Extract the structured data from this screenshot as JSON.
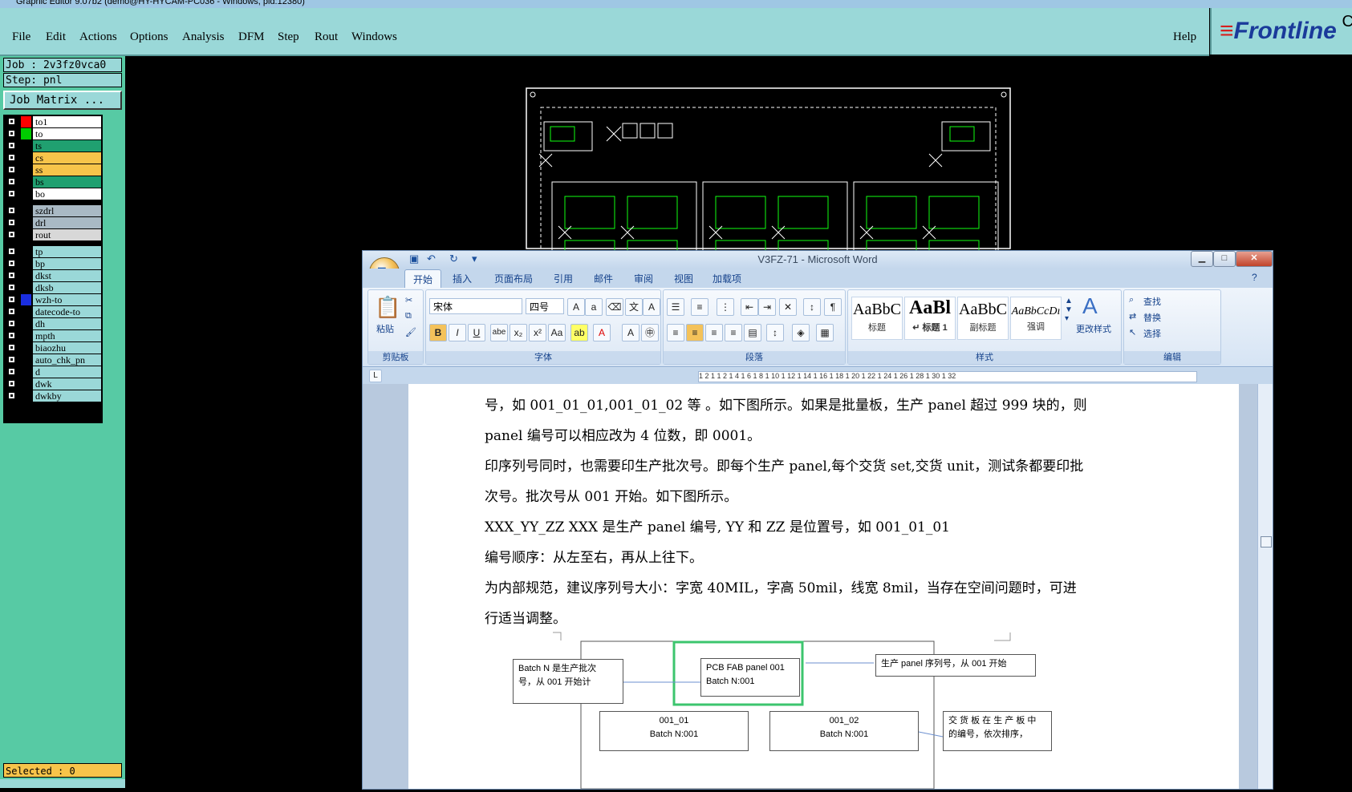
{
  "window_title": "Graphic Editor 9.07b2 (demo@HY-HYCAM-PC036 - Windows, pid:12380)",
  "menu": [
    {
      "label": "File"
    },
    {
      "label": "Edit"
    },
    {
      "label": "Actions"
    },
    {
      "label": "Options"
    },
    {
      "label": "Analysis"
    },
    {
      "label": "DFM"
    },
    {
      "label": "Step"
    },
    {
      "label": "Rout"
    },
    {
      "label": "Windows"
    }
  ],
  "help_label": "Help",
  "logo_text": "Frontline",
  "logo_suffix": "C",
  "job_info": "Job : 2v3fz0vca0",
  "step_info": "Step: pnl",
  "job_matrix_label": "Job Matrix ...",
  "selected_label": "Selected : 0",
  "layers": [
    {
      "name": "to1",
      "bg": "#ffffff",
      "swatch": "#ff0000"
    },
    {
      "name": "to",
      "bg": "#ffffff",
      "swatch": "#00cc00"
    },
    {
      "name": "ts",
      "bg": "#20a070",
      "swatch": ""
    },
    {
      "name": "cs",
      "bg": "#f7c44a",
      "swatch": ""
    },
    {
      "name": "ss",
      "bg": "#f7c44a",
      "swatch": ""
    },
    {
      "name": "bs",
      "bg": "#20a070",
      "swatch": ""
    },
    {
      "name": "bo",
      "bg": "#ffffff",
      "swatch": ""
    },
    {
      "name": "szdrl",
      "bg": "#a9b9c4",
      "swatch": ""
    },
    {
      "name": "drl",
      "bg": "#a9b9c4",
      "swatch": ""
    },
    {
      "name": "rout",
      "bg": "#d8d8d8",
      "swatch": ""
    },
    {
      "name": "tp",
      "bg": "#9ad8d8",
      "swatch": ""
    },
    {
      "name": "bp",
      "bg": "#9ad8d8",
      "swatch": ""
    },
    {
      "name": "dkst",
      "bg": "#9ad8d8",
      "swatch": ""
    },
    {
      "name": "dksb",
      "bg": "#9ad8d8",
      "swatch": ""
    },
    {
      "name": "wzh-to",
      "bg": "#9ad8d8",
      "swatch": "#1a2ee0"
    },
    {
      "name": "datecode-to",
      "bg": "#9ad8d8",
      "swatch": ""
    },
    {
      "name": "dh",
      "bg": "#9ad8d8",
      "swatch": ""
    },
    {
      "name": "mpth",
      "bg": "#9ad8d8",
      "swatch": ""
    },
    {
      "name": "biaozhu",
      "bg": "#9ad8d8",
      "swatch": ""
    },
    {
      "name": "auto_chk_pn",
      "bg": "#9ad8d8",
      "swatch": ""
    },
    {
      "name": "d",
      "bg": "#9ad8d8",
      "swatch": ""
    },
    {
      "name": "dwk",
      "bg": "#9ad8d8",
      "swatch": ""
    },
    {
      "name": "dwkby",
      "bg": "#9ad8d8",
      "swatch": ""
    }
  ],
  "word": {
    "title": "V3FZ-71 - Microsoft Word",
    "tabs": [
      "开始",
      "插入",
      "页面布局",
      "引用",
      "邮件",
      "审阅",
      "视图",
      "加载项"
    ],
    "groups": {
      "clipboard": "剪贴板",
      "font": "字体",
      "paragraph": "段落",
      "styles": "样式",
      "editing": "编辑"
    },
    "paste_label": "粘贴",
    "font_name": "宋体",
    "font_size": "四号",
    "styles": [
      {
        "sample": "AaBbC",
        "caption": "标题"
      },
      {
        "sample": "AaBl",
        "caption": "↵ 标题 1"
      },
      {
        "sample": "AaBbC",
        "caption": "副标题"
      },
      {
        "sample": "AaBbCcDı",
        "caption": "强调"
      }
    ],
    "change_styles": "更改样式",
    "find": "查找",
    "replace": "替换",
    "select": "选择",
    "ruler_text": "1 2 1   1   2 1   4 1   6 1   8 1  10 1  12 1  14 1  16 1  18 1  20 1  22 1  24 1  26 1  28 1  30 1  32",
    "paragraphs": [
      "号，如 001_01_01,001_01_02 等 。如下图所示。如果是批量板，生产 panel 超过 999 块的，则",
      "panel 编号可以相应改为 4 位数，即 0001。",
      "印序列号同时，也需要印生产批次号。即每个生产 panel,每个交货 set,交货 unit，测试条都要印批",
      "次号。批次号从 001 开始。如下图所示。",
      "XXX_YY_ZZ    XXX  是生产 panel 编号, YY   和   ZZ     是位置号，如 001_01_01",
      "编号顺序：从左至右，再从上往下。",
      "为内部规范，建议序列号大小：字宽 40MIL，字高 50mil，线宽 8mil，当存在空间问题时，可进",
      "行适当调整。"
    ],
    "diagram": {
      "batch_box": [
        "Batch  N  是生产批次",
        "号，从 001 开始计"
      ],
      "panel_box": [
        "PCB  FAB  panel  001",
        "Batch N:001"
      ],
      "serial_box": "生产  panel  序列号，从 001 开始",
      "unit1": [
        "001_01",
        "Batch N:001"
      ],
      "unit2": [
        "001_02",
        "Batch N:001"
      ],
      "note_box": [
        "交 货 板 在 生 产 板 中",
        "的编号，依次排序，"
      ]
    }
  }
}
